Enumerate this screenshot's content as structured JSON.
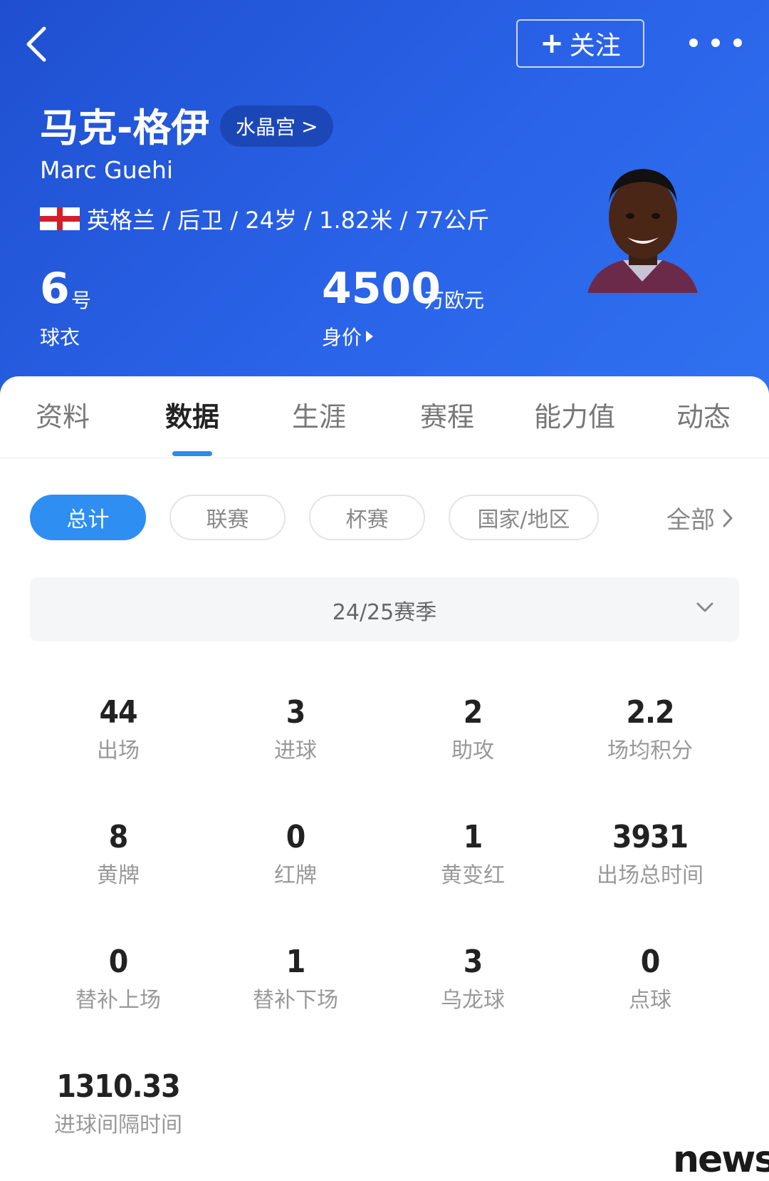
{
  "header": {
    "follow_label": "关注",
    "name_cn": "马克-格伊",
    "club": "水晶宫",
    "name_en": "Marc Guehi",
    "info": "英格兰 / 后卫 / 24岁 / 1.82米 / 77公斤",
    "jersey_number": "6",
    "jersey_unit": "号",
    "jersey_label": "球衣",
    "market_value": "4500",
    "market_value_unit": "万欧元",
    "market_value_label": "身价"
  },
  "tabs": [
    "资料",
    "数据",
    "生涯",
    "赛程",
    "能力值",
    "动态"
  ],
  "active_tab": "数据",
  "filters": {
    "chips": [
      "总计",
      "联赛",
      "杯赛",
      "国家/地区"
    ],
    "active": "总计",
    "all_label": "全部"
  },
  "season": "24/25赛季",
  "stats": [
    {
      "value": "44",
      "label": "出场"
    },
    {
      "value": "3",
      "label": "进球"
    },
    {
      "value": "2",
      "label": "助攻"
    },
    {
      "value": "2.2",
      "label": "场均积分"
    },
    {
      "value": "8",
      "label": "黄牌"
    },
    {
      "value": "0",
      "label": "红牌"
    },
    {
      "value": "1",
      "label": "黄变红"
    },
    {
      "value": "3931",
      "label": "出场总时间"
    },
    {
      "value": "0",
      "label": "替补上场"
    },
    {
      "value": "1",
      "label": "替补下场"
    },
    {
      "value": "3",
      "label": "乌龙球"
    },
    {
      "value": "0",
      "label": "点球"
    },
    {
      "value": "1310.33",
      "label": "进球间隔时间"
    }
  ],
  "watermark": "news",
  "colors": {
    "header_blue": "#2a63e8",
    "accent_blue": "#2e8ef2",
    "england_red": "#d41f2a"
  },
  "icons": [
    "back-arrow-icon",
    "more-dots-icon",
    "england-flag-icon",
    "chevron-right-icon",
    "chevron-down-icon",
    "triangle-right-icon"
  ]
}
